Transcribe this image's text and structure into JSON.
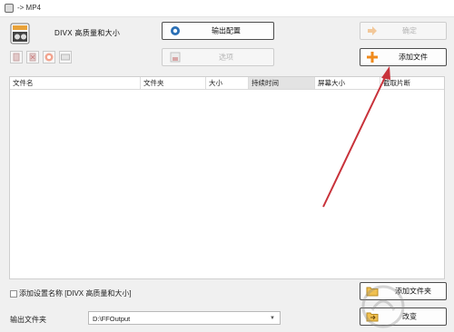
{
  "window": {
    "title": "-> MP4"
  },
  "profile": {
    "label": "DIVX 高质量和大小"
  },
  "buttons": {
    "output_settings": "输出配置",
    "confirm": "确定",
    "options": "选项",
    "add_file": "添加文件",
    "add_folder": "添加文件夹",
    "change": "改变"
  },
  "file_list": {
    "columns": [
      "文件名",
      "文件夹",
      "大小",
      "持续时间",
      "屏幕大小",
      "截取片断"
    ],
    "sorted_column": "持续时间"
  },
  "footer": {
    "add_setting_name_label": "添加设置名称 [DIVX 高质量和大小]",
    "add_setting_name_checked": false,
    "output_folder_label": "输出文件夹",
    "output_folder_value": "D:\\FFOutput"
  },
  "colors": {
    "accent_orange": "#f08a1c",
    "annotation_red": "#c8323a",
    "settings_blue": "#2a6fb5"
  }
}
